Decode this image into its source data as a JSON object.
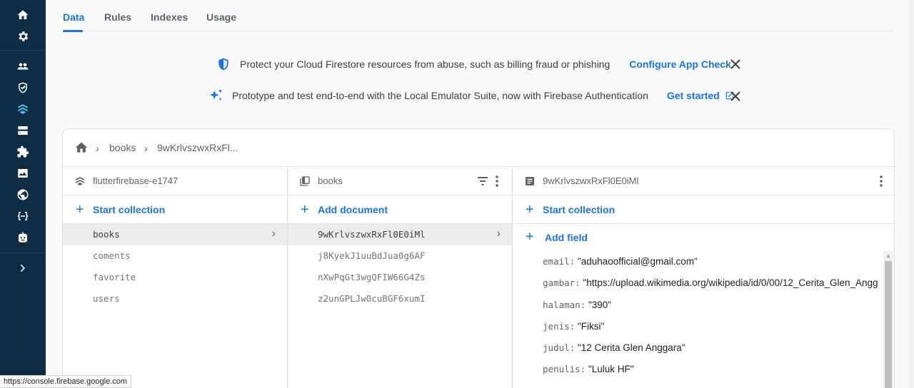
{
  "tabs": [
    "Data",
    "Rules",
    "Indexes",
    "Usage"
  ],
  "banners": {
    "appcheck": {
      "text": "Protect your Cloud Firestore resources from abuse, such as billing fraud or phishing",
      "link": "Configure App Check"
    },
    "emulator": {
      "text": "Prototype and test end-to-end with the Local Emulator Suite, now with Firebase Authentication",
      "link": "Get started"
    }
  },
  "breadcrumb": {
    "items": [
      "books",
      "9wKrlvszwxRxFl..."
    ]
  },
  "columns": {
    "root": {
      "title": "flutterfirebase-e1747",
      "action": "Start collection",
      "items": [
        "books",
        "coments",
        "favorite",
        "users"
      ]
    },
    "collection": {
      "title": "books",
      "action": "Add document",
      "items": [
        "9wKrlvszwxRxFl0E0iMl",
        "j8KyekJ1uuBdJua0g6AF",
        "nXwPqGt3wgQFIW66G4Zs",
        "z2unGPLJw0cuBGF6xumI"
      ]
    },
    "document": {
      "title": "9wKrlvszwxRxFl0E0iMl",
      "action": "Start collection",
      "add_field": "Add field",
      "fields": [
        {
          "key": "email:",
          "value": "\"aduhaoofficial@gmail.com\""
        },
        {
          "key": "gambar:",
          "value": "\"https://upload.wikimedia.org/wikipedia/id/0/00/12_Cerita_Glen_Angg"
        },
        {
          "key": "halaman:",
          "value": "\"390\""
        },
        {
          "key": "jenis:",
          "value": "\"Fiksi\""
        },
        {
          "key": "judul:",
          "value": "\"12 Cerita Glen Anggara\""
        },
        {
          "key": "penulis:",
          "value": "\"Luluk HF\""
        }
      ]
    }
  },
  "status_url": "https://console.firebase.google.com",
  "colors": {
    "accent": "#1a73e8",
    "rail": "#0f2c45",
    "active_icon": "#4fc3f7"
  },
  "icons": [
    "home-icon",
    "settings-icon",
    "users-icon",
    "shield-icon",
    "firestore-icon",
    "storage-icon",
    "extensions-icon",
    "image-icon",
    "globe-icon",
    "functions-icon",
    "robot-icon",
    "expand-icon"
  ]
}
